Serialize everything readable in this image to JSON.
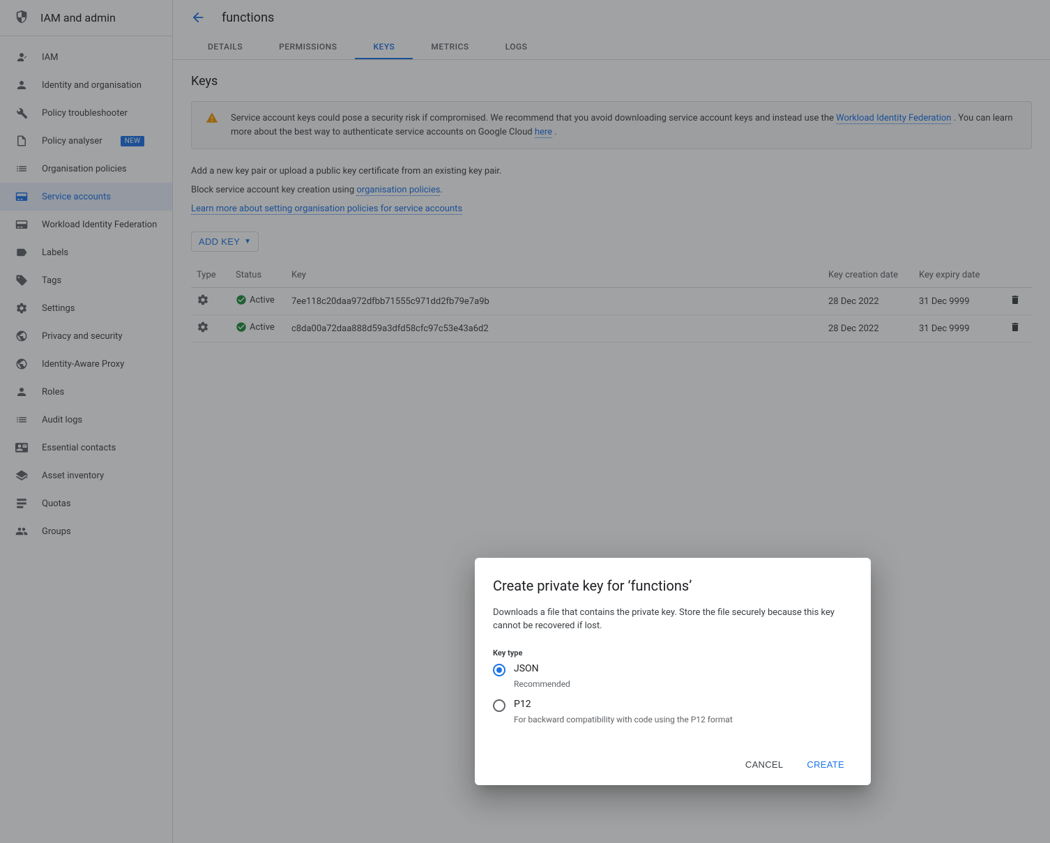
{
  "sidebar": {
    "title": "IAM and admin",
    "items": [
      {
        "label": "IAM"
      },
      {
        "label": "Identity and organisation"
      },
      {
        "label": "Policy troubleshooter"
      },
      {
        "label": "Policy analyser",
        "badge": "NEW"
      },
      {
        "label": "Organisation policies"
      },
      {
        "label": "Service accounts",
        "active": true
      },
      {
        "label": "Workload Identity Federation"
      },
      {
        "label": "Labels"
      },
      {
        "label": "Tags"
      },
      {
        "label": "Settings"
      },
      {
        "label": "Privacy and security"
      },
      {
        "label": "Identity-Aware Proxy"
      },
      {
        "label": "Roles"
      },
      {
        "label": "Audit logs"
      },
      {
        "label": "Essential contacts"
      },
      {
        "label": "Asset inventory"
      },
      {
        "label": "Quotas"
      },
      {
        "label": "Groups"
      }
    ]
  },
  "header": {
    "title": "functions"
  },
  "tabs": [
    {
      "label": "DETAILS"
    },
    {
      "label": "PERMISSIONS"
    },
    {
      "label": "KEYS",
      "active": true
    },
    {
      "label": "METRICS"
    },
    {
      "label": "LOGS"
    }
  ],
  "keys_section": {
    "heading": "Keys",
    "banner_prefix": "Service account keys could pose a security risk if compromised. We recommend that you avoid downloading service account keys and instead use the ",
    "banner_link1": "Workload Identity Federation",
    "banner_mid": " . You can learn more about the best way to authenticate service accounts on Google Cloud ",
    "banner_link2": "here",
    "banner_suffix": " .",
    "para1": "Add a new key pair or upload a public key certificate from an existing key pair.",
    "para2_prefix": "Block service account key creation using ",
    "para2_link": "organisation policies",
    "para2_suffix": ".",
    "para3_link": "Learn more about setting organisation policies for service accounts",
    "add_key": "ADD KEY",
    "columns": {
      "type": "Type",
      "status": "Status",
      "key": "Key",
      "created": "Key creation date",
      "expires": "Key expiry date"
    },
    "status_label": "Active",
    "rows": [
      {
        "key": "7ee118c20daa972dfbb71555c971dd2fb79e7a9b",
        "created": "28 Dec 2022",
        "expires": "31 Dec 9999"
      },
      {
        "key": "c8da00a72daa888d59a3dfd58cfc97c53e43a6d2",
        "created": "28 Dec 2022",
        "expires": "31 Dec 9999"
      }
    ]
  },
  "dialog": {
    "title": "Create private key for ‘functions’",
    "desc": "Downloads a file that contains the private key. Store the file securely because this key cannot be recovered if lost.",
    "field_label": "Key type",
    "opt1": "JSON",
    "opt1_sub": "Recommended",
    "opt2": "P12",
    "opt2_sub": "For backward compatibility with code using the P12 format",
    "cancel": "CANCEL",
    "create": "CREATE"
  }
}
